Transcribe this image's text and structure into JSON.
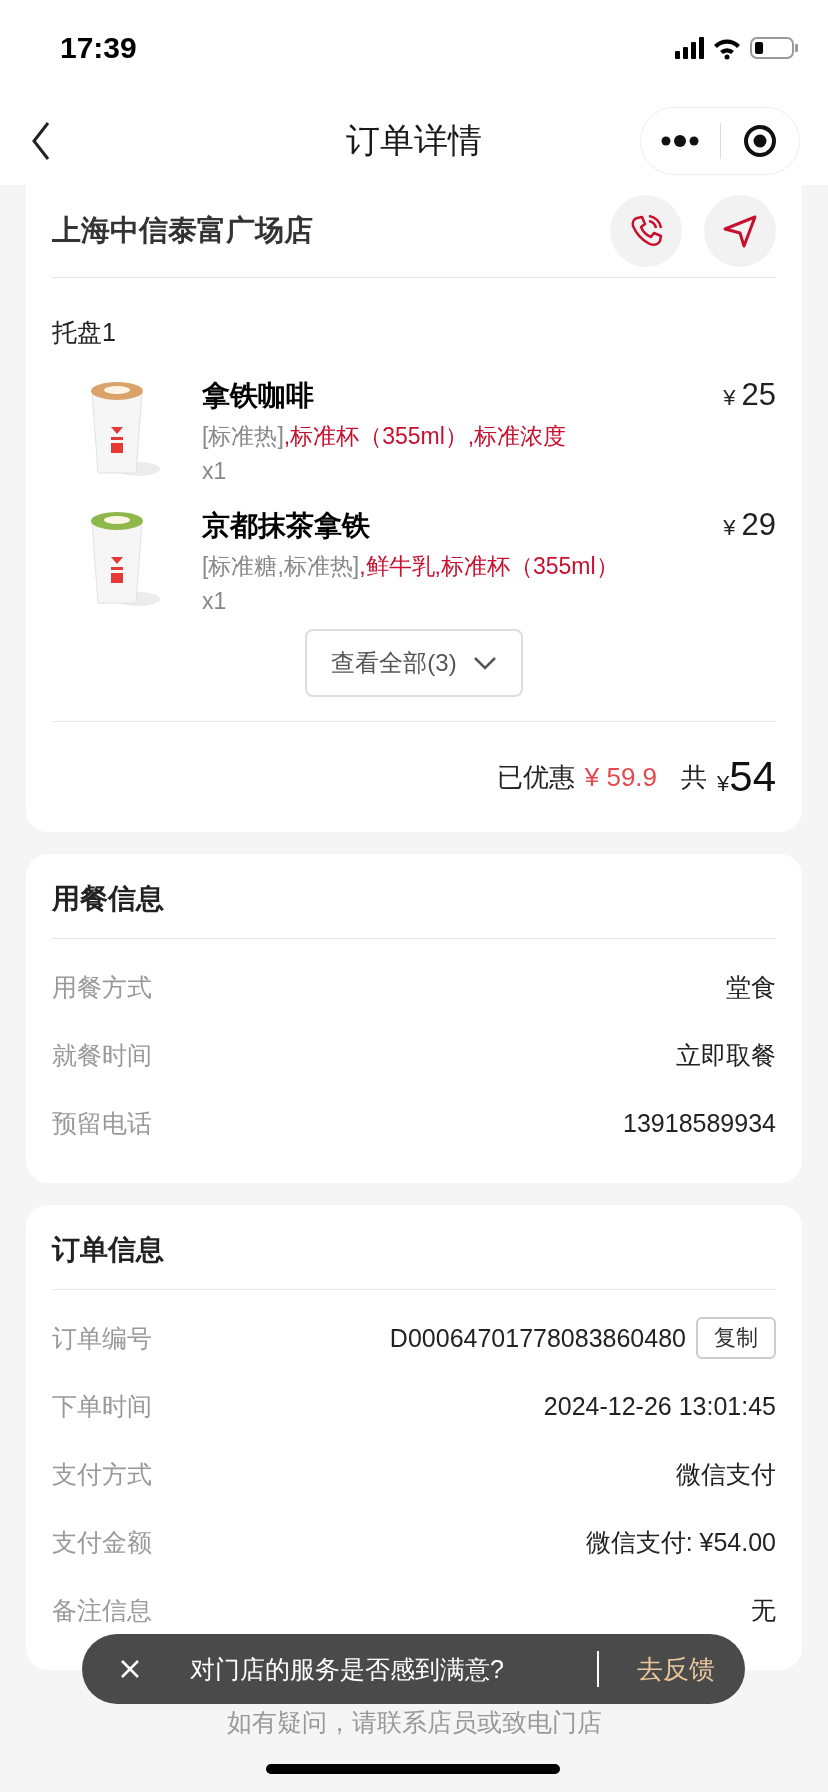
{
  "status_bar": {
    "time": "17:39"
  },
  "nav": {
    "title": "订单详情"
  },
  "store": {
    "name": "上海中信泰富广场店"
  },
  "tray": {
    "label": "托盘1",
    "items": [
      {
        "name": "拿铁咖啡",
        "options_base": "[标准热]",
        "options_extra": ",标准杯（355ml）,标准浓度",
        "quantity": "x1",
        "currency": "¥",
        "price": "25"
      },
      {
        "name": "京都抹茶拿铁",
        "options_base": "[标准糖,标准热]",
        "options_extra": ",鲜牛乳,标准杯（355ml）",
        "quantity": "x1",
        "currency": "¥",
        "price": "29"
      }
    ],
    "view_all": "查看全部(3)"
  },
  "totals": {
    "discount_label": "已优惠",
    "discount": "¥ 59.9",
    "total_label": "共",
    "currency": "¥",
    "total": "54"
  },
  "sections": [
    {
      "title": "用餐信息",
      "rows": [
        {
          "kind": "plain",
          "label": "用餐方式",
          "value": "堂食"
        },
        {
          "kind": "plain",
          "label": "就餐时间",
          "value": "立即取餐"
        },
        {
          "kind": "plain",
          "label": "预留电话",
          "value": "13918589934"
        }
      ]
    },
    {
      "title": "订单信息",
      "rows": [
        {
          "kind": "copy",
          "label": "订单编号",
          "value": "D00064701778083860480",
          "action": "复制"
        },
        {
          "kind": "plain",
          "label": "下单时间",
          "value": "2024-12-26 13:01:45"
        },
        {
          "kind": "plain",
          "label": "支付方式",
          "value": "微信支付"
        },
        {
          "kind": "plain",
          "label": "支付金额",
          "value": "微信支付: ¥54.00"
        },
        {
          "kind": "plain",
          "label": "备注信息",
          "value": "无"
        }
      ]
    }
  ],
  "toast": {
    "message": "对门店的服务是否感到满意?",
    "action": "去反馈"
  },
  "footer": {
    "note": "如有疑问，请联系店员或致电门店"
  }
}
